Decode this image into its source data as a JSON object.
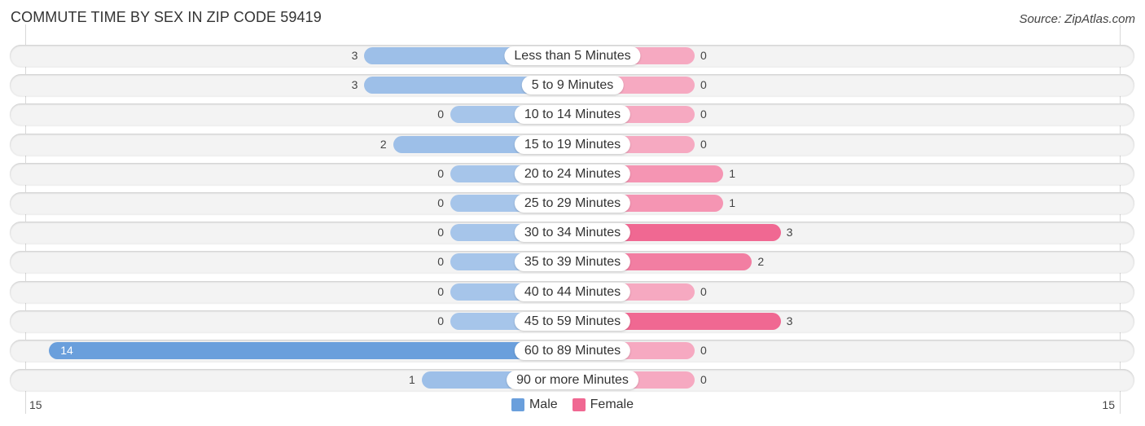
{
  "title": "COMMUTE TIME BY SEX IN ZIP CODE 59419",
  "source": "Source: ZipAtlas.com",
  "colors": {
    "male": "#6a9fdc",
    "male_light": "#a6c5ea",
    "female": "#f06892",
    "female_light": "#f6a9c1"
  },
  "chart_data": {
    "type": "bar",
    "orientation": "horizontal-diverging",
    "title": "COMMUTE TIME BY SEX IN ZIP CODE 59419",
    "categories": [
      "Less than 5 Minutes",
      "5 to 9 Minutes",
      "10 to 14 Minutes",
      "15 to 19 Minutes",
      "20 to 24 Minutes",
      "25 to 29 Minutes",
      "30 to 34 Minutes",
      "35 to 39 Minutes",
      "40 to 44 Minutes",
      "45 to 59 Minutes",
      "60 to 89 Minutes",
      "90 or more Minutes"
    ],
    "series": [
      {
        "name": "Male",
        "values": [
          3,
          3,
          0,
          2,
          0,
          0,
          0,
          0,
          0,
          0,
          14,
          1
        ]
      },
      {
        "name": "Female",
        "values": [
          0,
          0,
          0,
          0,
          1,
          1,
          3,
          2,
          0,
          3,
          0,
          0
        ]
      }
    ],
    "axis": {
      "left_label": "15",
      "right_label": "15",
      "xlim": [
        -15,
        15
      ]
    },
    "legend": {
      "entries": [
        "Male",
        "Female"
      ],
      "placement": "bottom-center"
    },
    "grid": false
  }
}
